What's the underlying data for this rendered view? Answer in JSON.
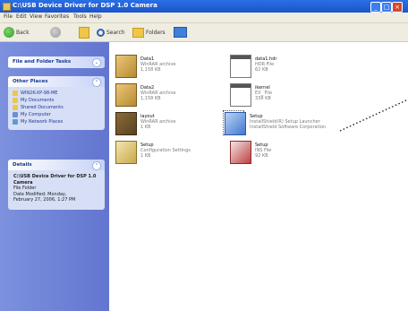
{
  "window": {
    "title": "C:\\USB Device Driver for DSP 1.0 Camera"
  },
  "menu": [
    "File",
    "Edit",
    "View",
    "Favorites",
    "Tools",
    "Help"
  ],
  "toolbar": {
    "back_label": "Back",
    "search_label": "Search",
    "folders_label": "Folders"
  },
  "sidebar": {
    "panels": [
      {
        "title": "File and Folder Tasks"
      },
      {
        "title": "Other Places",
        "links": [
          "WIN2K-XP-98-ME",
          "My Documents",
          "Shared Documents",
          "My Computer",
          "My Network Places"
        ]
      },
      {
        "title": "Details",
        "details": [
          "C:\\USB Device Driver for DSP 1.0 Camera",
          "File Folder",
          "Date Modified: Monday,",
          "February 27, 2006, 1:27 PM"
        ]
      }
    ]
  },
  "files": [
    {
      "name": "Data1",
      "line2": "WinRAR archive",
      "line3": "1,158 KB",
      "icon": "archive-icon"
    },
    {
      "name": "data1.hdr",
      "line2": "HDR File",
      "line3": "62 KB",
      "icon": "file-icon"
    },
    {
      "name": "Data2",
      "line2": "WinRAR archive",
      "line3": "1,158 KB",
      "icon": "archive-icon"
    },
    {
      "name": "ikernel",
      "line2": "EX_ File",
      "line3": "338 KB",
      "icon": "file-icon"
    },
    {
      "name": "layout",
      "line2": "WinRAR archive",
      "line3": "1 KB",
      "icon": "package-icon"
    },
    {
      "name": "Setup",
      "line2": "InstallShield(R) Setup Launcher",
      "line3": "InstallShield Software Corporation",
      "icon": "setup-icon"
    },
    {
      "name": "Setup",
      "line2": "Configuration Settings",
      "line3": "1 KB",
      "icon": "settings-icon"
    },
    {
      "name": "Setup",
      "line2": "INS File",
      "line3": "92 KB",
      "icon": "ins-file-icon"
    }
  ]
}
